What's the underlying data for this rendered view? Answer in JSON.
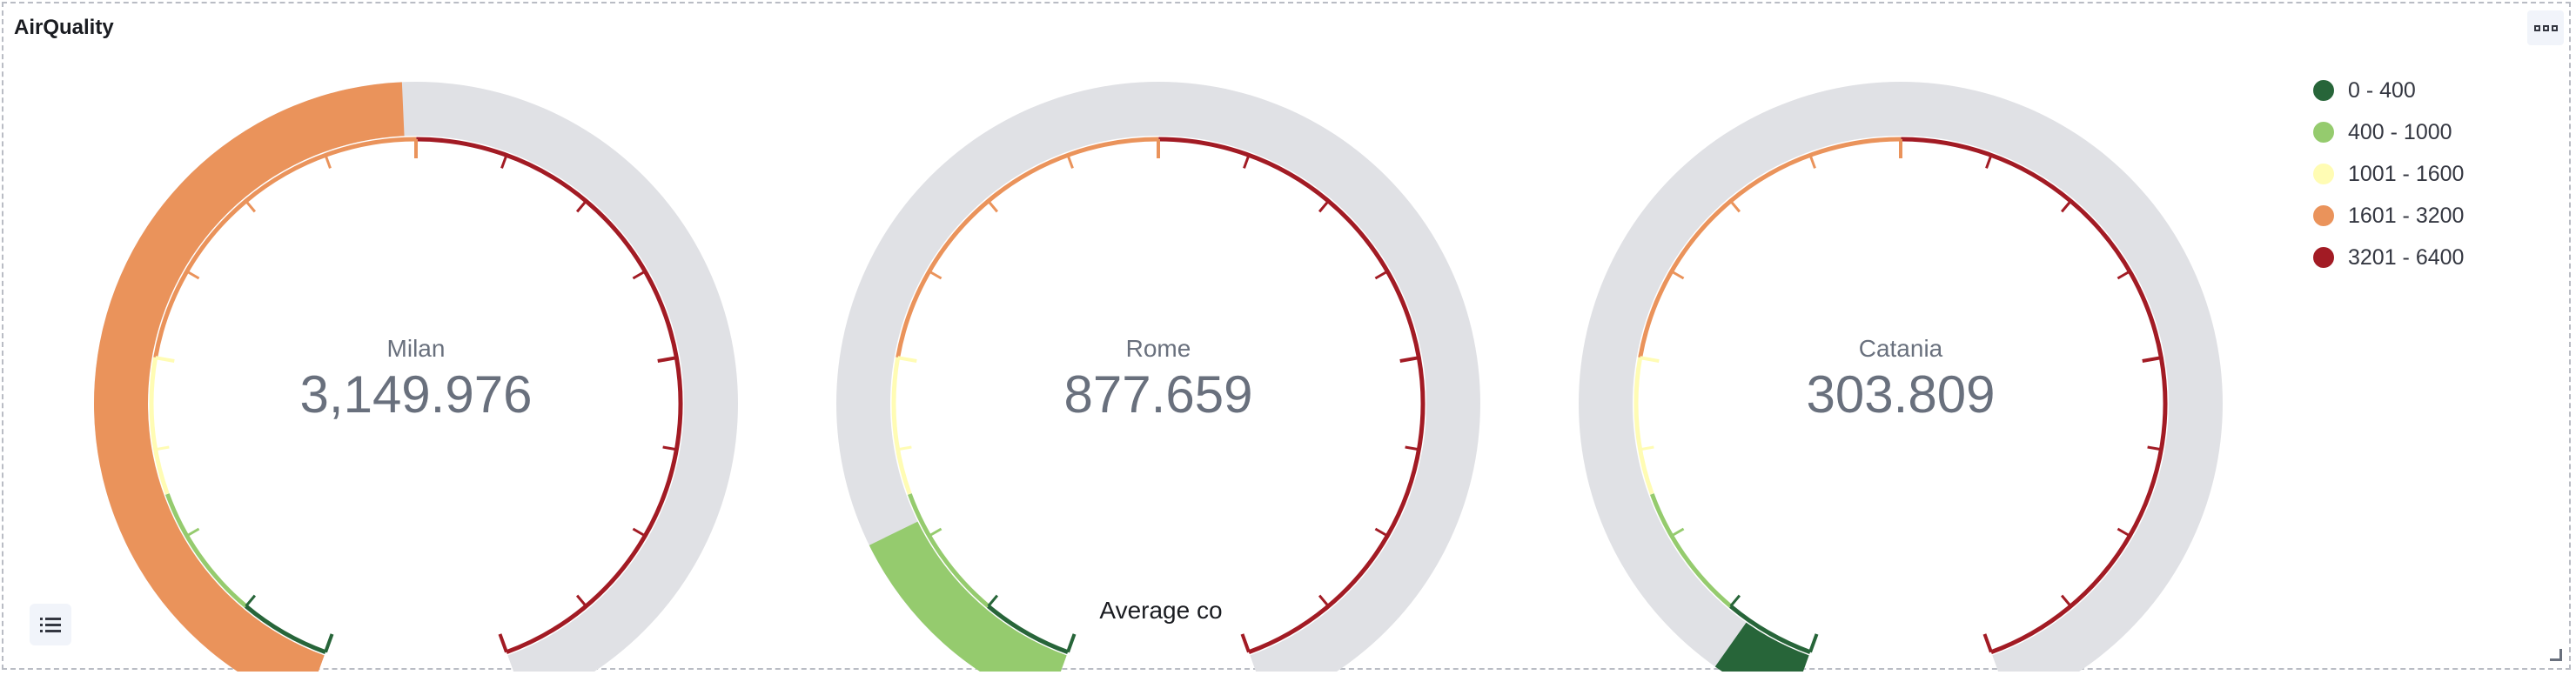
{
  "panel": {
    "title": "AirQuality",
    "footer_label": "Average co",
    "menu_icon": "options-icon",
    "legend_toggle_icon": "list-icon",
    "resize_icon": "resize-icon"
  },
  "colors": {
    "track": "#e0e1e5",
    "text_muted": "#69707d",
    "bands": [
      "#276539",
      "#95cb6e",
      "#fffcb4",
      "#ea935b",
      "#a21b24"
    ]
  },
  "chart_data": {
    "type": "gauge",
    "title": "",
    "scale": {
      "min": 0,
      "max": 6400
    },
    "ranges": [
      {
        "label": "0 - 400",
        "from": 0,
        "to": 400,
        "color": "#276539"
      },
      {
        "label": "400 - 1000",
        "from": 400,
        "to": 1000,
        "color": "#95cb6e"
      },
      {
        "label": "1001 - 1600",
        "from": 1001,
        "to": 1600,
        "color": "#fffcb4"
      },
      {
        "label": "1601 - 3200",
        "from": 1601,
        "to": 3200,
        "color": "#ea935b"
      },
      {
        "label": "3201 - 6400",
        "from": 3201,
        "to": 6400,
        "color": "#a21b24"
      }
    ],
    "gauges": [
      {
        "name": "Milan",
        "value": 3149.976,
        "display": "3,149.976"
      },
      {
        "name": "Rome",
        "value": 877.659,
        "display": "877.659"
      },
      {
        "name": "Catania",
        "value": 303.809,
        "display": "303.809"
      }
    ],
    "legend_position": "top-right",
    "xlabel": "Average co"
  }
}
